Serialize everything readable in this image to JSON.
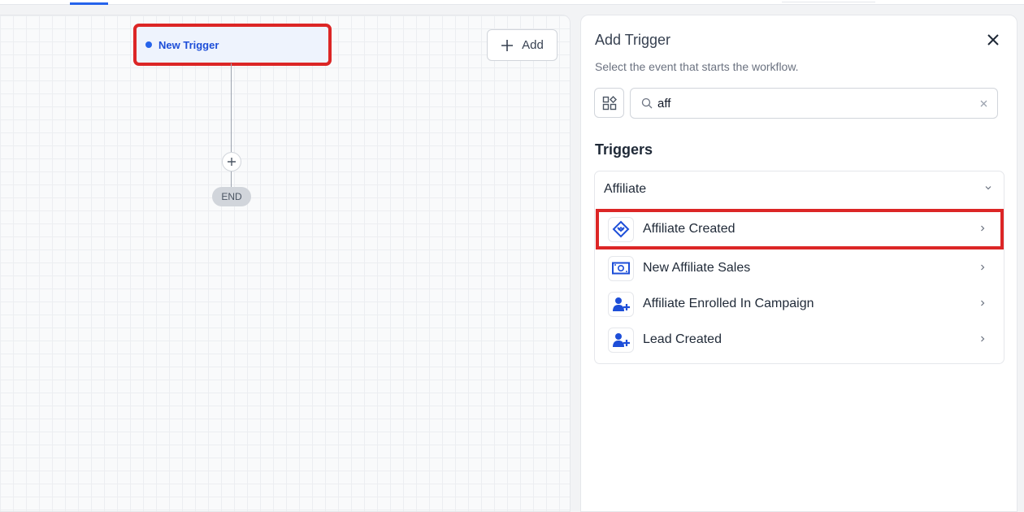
{
  "canvas": {
    "trigger_node": {
      "label": "New Trigger"
    },
    "add_button": {
      "label": "Add"
    },
    "end_node": {
      "label": "END"
    }
  },
  "panel": {
    "title": "Add Trigger",
    "subtitle": "Select the event that starts the workflow.",
    "search": {
      "value": "aff",
      "placeholder": ""
    },
    "section_title": "Triggers",
    "group": {
      "name": "Affiliate",
      "items": [
        {
          "label": "Affiliate Created",
          "icon": "affiliate-handshake-icon",
          "highlighted": true
        },
        {
          "label": "New Affiliate Sales",
          "icon": "money-bill-icon",
          "highlighted": false
        },
        {
          "label": "Affiliate Enrolled In Campaign",
          "icon": "user-plus-icon",
          "highlighted": false
        },
        {
          "label": "Lead Created",
          "icon": "user-plus-icon",
          "highlighted": false
        }
      ]
    }
  },
  "colors": {
    "accent": "#2563eb",
    "highlight": "#dc2626",
    "icon_blue": "#1d4ed8"
  }
}
